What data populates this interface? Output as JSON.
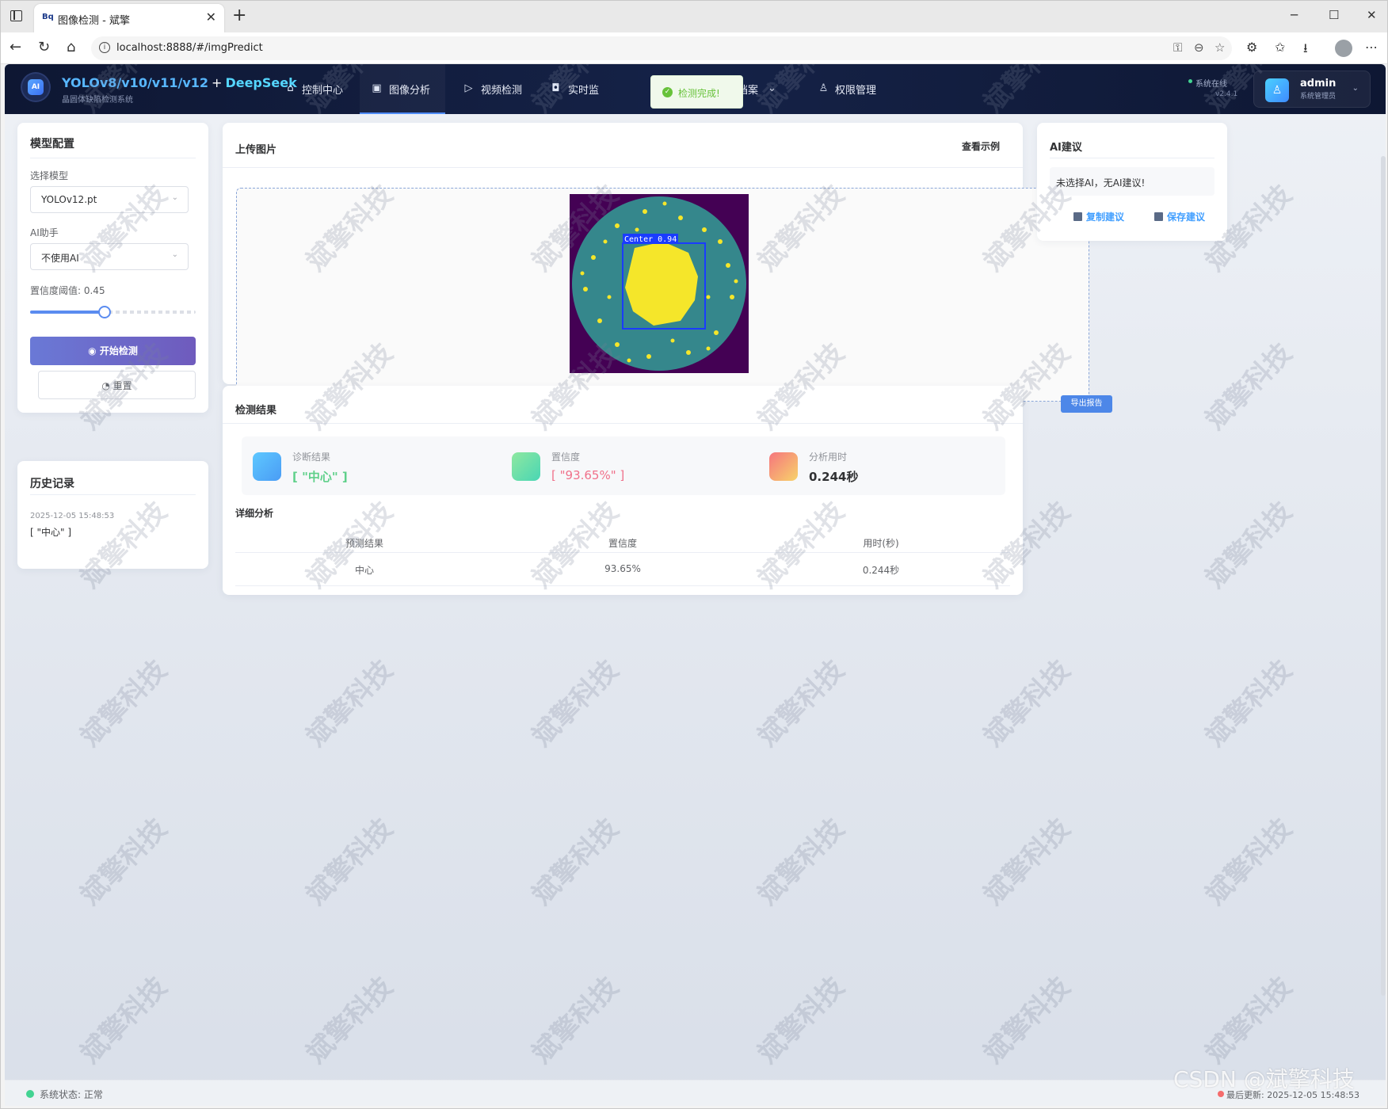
{
  "browser": {
    "tab_title": "图像检测 - 斌擎",
    "tab_favicon": "Bq",
    "url": "localhost:8888/#/imgPredict"
  },
  "app": {
    "brand": "YOLOv8/v10/v11/v12",
    "brand_plus": "+",
    "brand_ai": "DeepSeek",
    "subtitle": "晶圆体缺陷检测系统",
    "logo_text": "AI",
    "nav": [
      {
        "label": "控制中心",
        "icon": "home-icon"
      },
      {
        "label": "图像分析",
        "icon": "image-icon"
      },
      {
        "label": "视频检测",
        "icon": "play-icon"
      },
      {
        "label": "实时监",
        "icon": "camera-icon"
      },
      {
        "label": "档案",
        "icon": "chevron-down-icon"
      },
      {
        "label": "权限管理",
        "icon": "user-icon"
      }
    ],
    "toast": "检测完成!",
    "status_online": "系统在线",
    "version": "v2.4.1",
    "user_name": "admin",
    "user_role": "系统管理员"
  },
  "config": {
    "title": "模型配置",
    "model_label": "选择模型",
    "model_value": "YOLOv12.pt",
    "ai_label": "AI助手",
    "ai_value": "不使用AI",
    "threshold_label": "置信度阈值: 0.45",
    "threshold_value": 0.45,
    "start_button": "开始检测",
    "reset_button": "重置"
  },
  "history": {
    "title": "历史记录",
    "items": [
      {
        "time": "2025-12-05 15:48:53",
        "result": "[ \"中心\" ]"
      }
    ]
  },
  "upload": {
    "title": "上传图片",
    "example_link": "查看示例",
    "detection_label": "Center 0.94"
  },
  "results": {
    "title": "检测结果",
    "export_button": "导出报告",
    "stats": [
      {
        "key": "诊断结果",
        "value": "[ \"中心\" ]",
        "color": "#5fd08a"
      },
      {
        "key": "置信度",
        "value": "[ \"93.65%\" ]",
        "color": "#f0708a"
      },
      {
        "key": "分析用时",
        "value": "0.244秒",
        "color": "#303133"
      }
    ],
    "detail_title": "详细分析",
    "columns": [
      "预测结果",
      "置信度",
      "用时(秒)"
    ],
    "rows": [
      [
        "中心",
        "93.65%",
        "0.244秒"
      ]
    ]
  },
  "ai": {
    "title": "AI建议",
    "message": "未选择AI，无AI建议!",
    "copy_button": "复制建议",
    "save_button": "保存建议"
  },
  "footer": {
    "status": "系统状态: 正常",
    "updated": "最后更新: 2025-12-05 15:48:53"
  },
  "watermark": "斌擎科技",
  "corner_watermark": "CSDN @斌擎科技",
  "colors": {
    "accent": "#4f8cff",
    "header_bg": "#0e1733",
    "primary_button": "#6a79d6",
    "wafer_bg": "#440154",
    "wafer_body": "#35878c",
    "defect": "#f5e62a",
    "bbox": "#1a3cff"
  }
}
